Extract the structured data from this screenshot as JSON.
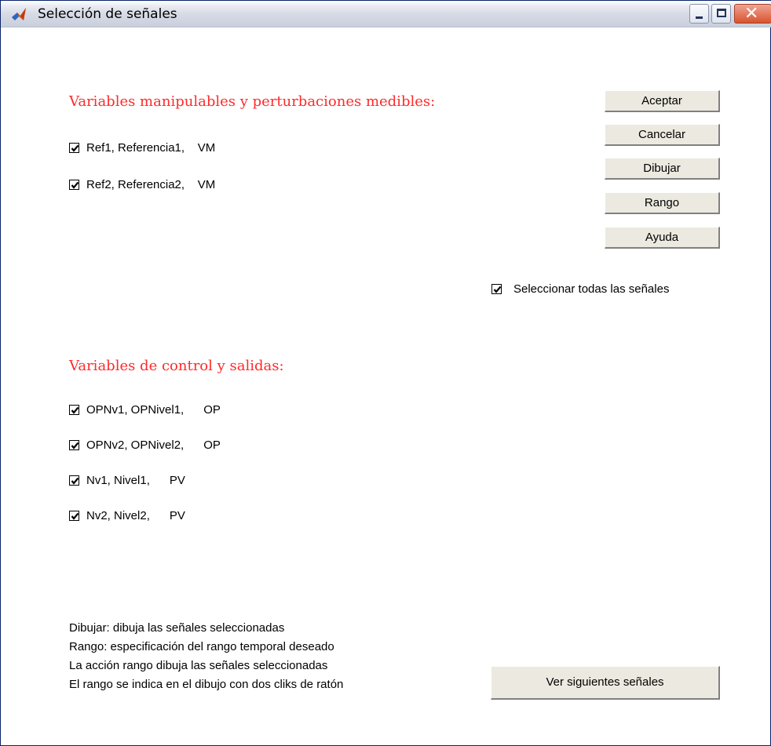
{
  "window": {
    "title": "Selección de señales"
  },
  "section_mv": {
    "heading": "Variables manipulables y perturbaciones medibles:",
    "items": [
      {
        "label": "Ref1, Referencia1,    VM",
        "checked": true
      },
      {
        "label": "Ref2, Referencia2,    VM",
        "checked": true
      }
    ]
  },
  "section_cv": {
    "heading": "Variables de control y salidas:",
    "items": [
      {
        "label": "OPNv1, OPNivel1,      OP",
        "checked": true
      },
      {
        "label": "OPNv2, OPNivel2,      OP",
        "checked": true
      },
      {
        "label": "Nv1, Nivel1,      PV",
        "checked": true
      },
      {
        "label": "Nv2, Nivel2,      PV",
        "checked": true
      }
    ]
  },
  "buttons": {
    "aceptar": "Aceptar",
    "cancelar": "Cancelar",
    "dibujar": "Dibujar",
    "rango": "Rango",
    "ayuda": "Ayuda",
    "next": "Ver siguientes señales"
  },
  "select_all": {
    "label": "Seleccionar todas las señales",
    "checked": true
  },
  "help_lines": [
    "Dibujar: dibuja las señales seleccionadas",
    "Rango: especificación del rango temporal deseado",
    "La acción rango dibuja las señales seleccionadas",
    "El rango se indica en el dibujo con dos cliks de ratón"
  ],
  "colors": {
    "heading": "#ff2a2a",
    "button_face": "#ece9e0"
  }
}
